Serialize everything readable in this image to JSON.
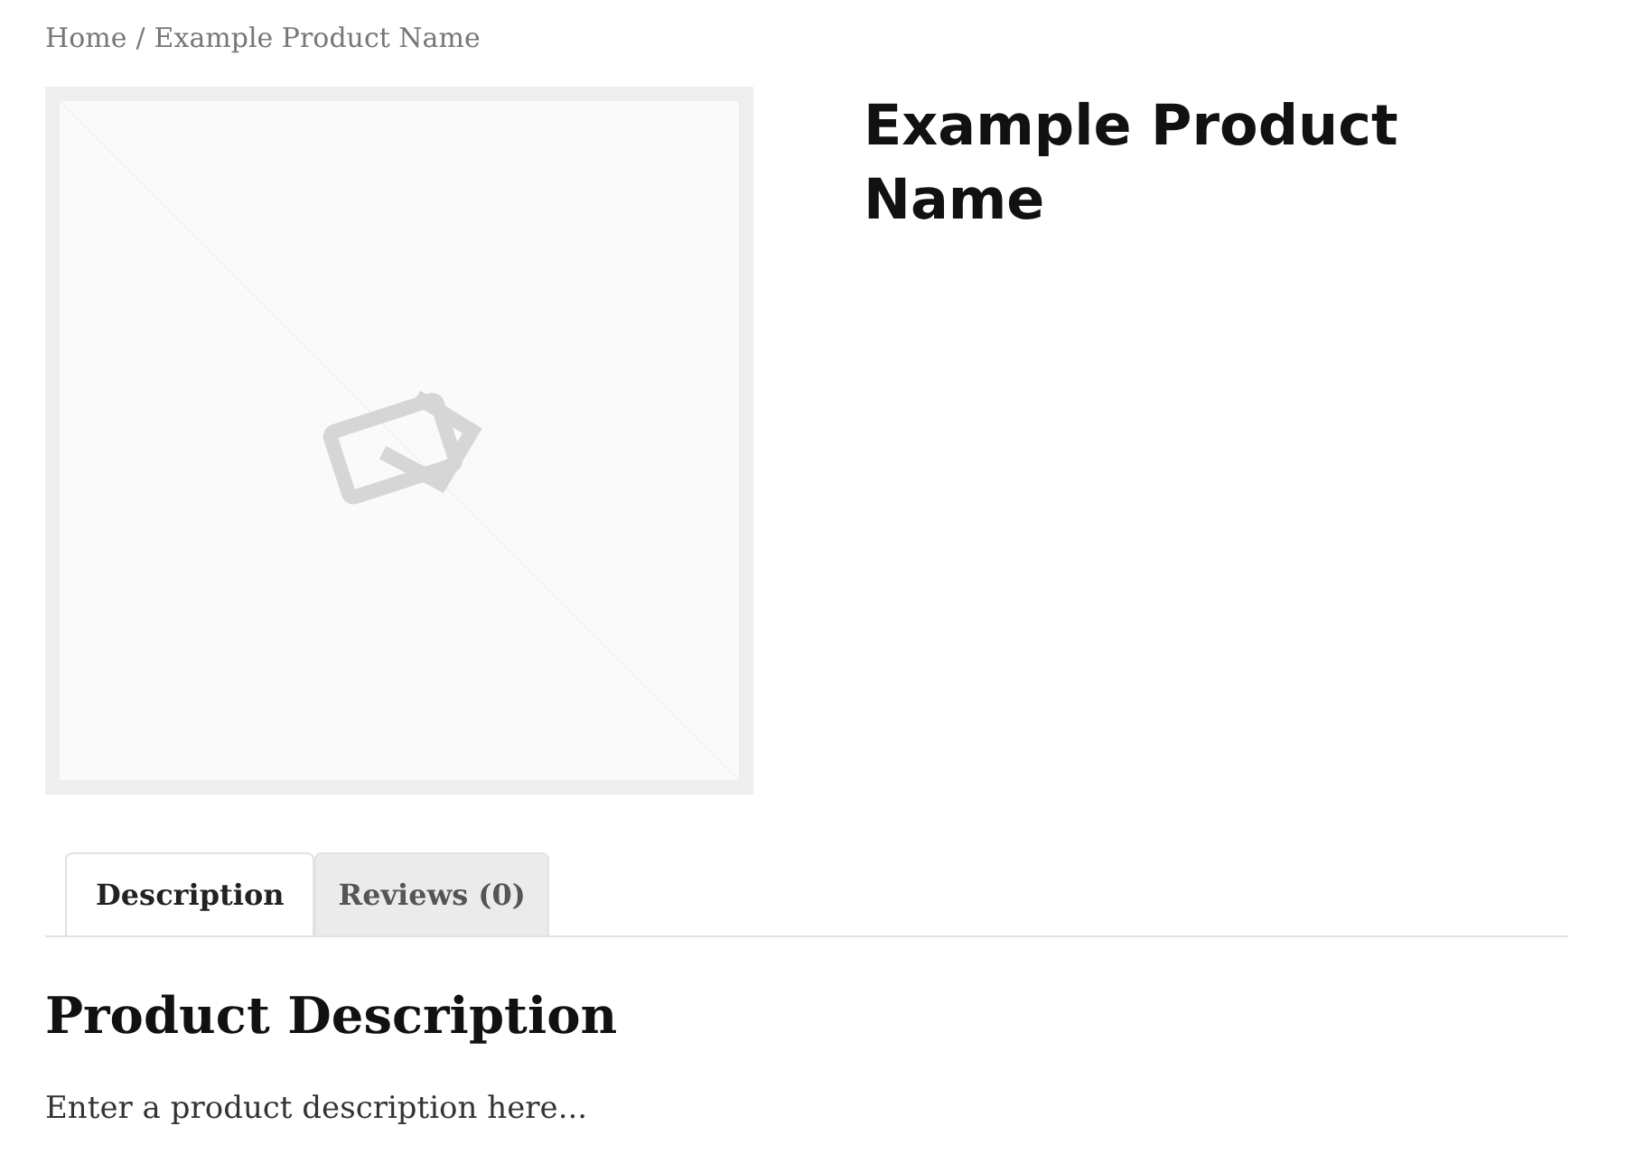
{
  "breadcrumb": {
    "items": [
      "Home",
      "Example Product Name"
    ],
    "separator": "/"
  },
  "product": {
    "title": "Example Product Name",
    "image": {
      "kind": "placeholder"
    }
  },
  "tabs": [
    {
      "label": "Description",
      "selected": true
    },
    {
      "label": "Reviews (0)",
      "selected": false
    }
  ],
  "description": {
    "heading": "Product Description",
    "text": "Enter a product description here..."
  }
}
